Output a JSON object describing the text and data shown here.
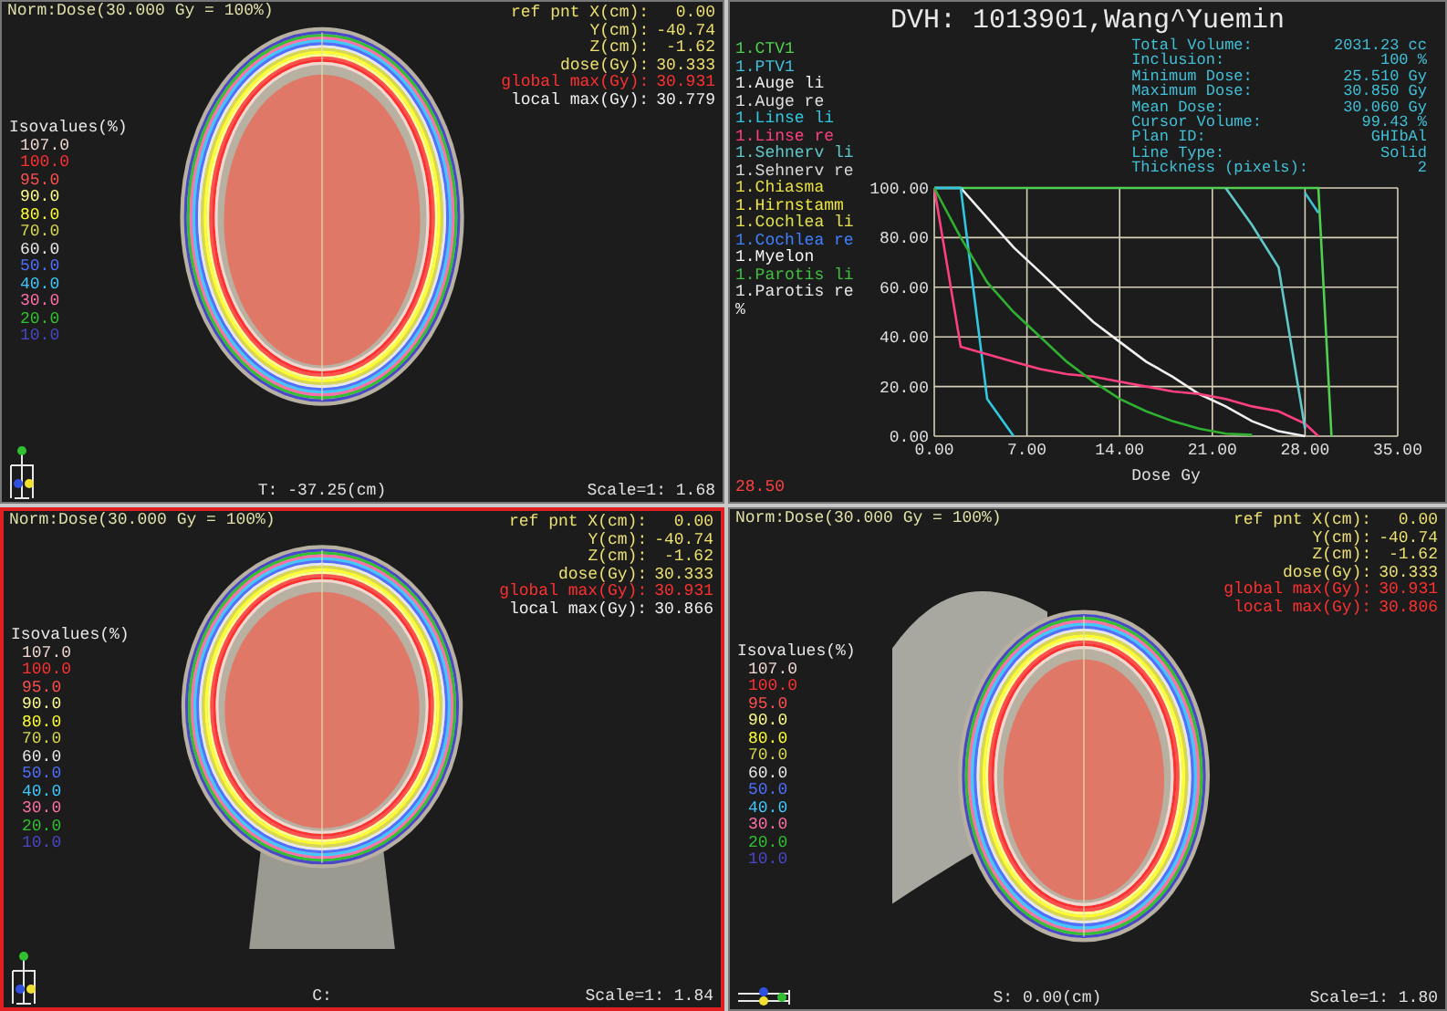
{
  "panels": [
    {
      "kind": "axial",
      "selected": false,
      "norm": "Norm:Dose(30.000 Gy = 100%)",
      "ref": [
        {
          "label": "ref pnt X(cm):",
          "value": "0.00",
          "kind": "value"
        },
        {
          "label": "Y(cm):",
          "value": "-40.74",
          "kind": "value"
        },
        {
          "label": "Z(cm):",
          "value": "-1.62",
          "kind": "value"
        },
        {
          "label": "dose(Gy):",
          "value": "30.333",
          "kind": "value"
        },
        {
          "label": "global max(Gy):",
          "value": "30.931",
          "kind": "global"
        },
        {
          "label": "local max(Gy):",
          "value": "30.779",
          "kind": "local"
        }
      ],
      "isovalues_title": "Isovalues(%)",
      "isovalues": [
        {
          "label": "107.0",
          "color": "#f0d8d0"
        },
        {
          "label": "100.0",
          "color": "#ff3030"
        },
        {
          "label": "95.0",
          "color": "#ff5050"
        },
        {
          "label": "90.0",
          "color": "#ffff90"
        },
        {
          "label": "80.0",
          "color": "#ffff30"
        },
        {
          "label": "70.0",
          "color": "#d8d850"
        },
        {
          "label": "60.0",
          "color": "#e8e8e8"
        },
        {
          "label": "50.0",
          "color": "#5070ff"
        },
        {
          "label": "40.0",
          "color": "#40c8ff"
        },
        {
          "label": "30.0",
          "color": "#ff70a8"
        },
        {
          "label": "20.0",
          "color": "#30c030"
        },
        {
          "label": "10.0",
          "color": "#4848c8"
        }
      ],
      "position": "T: -37.25(cm)",
      "scale": "Scale=1: 1.68"
    },
    {
      "kind": "dvh",
      "selected": false,
      "title": "DVH: 1013901,Wang^Yuemin",
      "structures": [
        {
          "label": "1.CTV1",
          "color": "#50d050"
        },
        {
          "label": "1.PTV1",
          "color": "#40c0d8"
        },
        {
          "label": "1.Auge li",
          "color": "#f0f0f0"
        },
        {
          "label": "1.Auge re",
          "color": "#e0e0e0"
        },
        {
          "label": "1.Linse li",
          "color": "#30c8e0"
        },
        {
          "label": "1.Linse re",
          "color": "#ff4080"
        },
        {
          "label": "1.Sehnerv li",
          "color": "#60c8c8"
        },
        {
          "label": "1.Sehnerv re",
          "color": "#d8d8d8"
        },
        {
          "label": "1.Chiasma",
          "color": "#e8e040"
        },
        {
          "label": "1.Hirnstamm",
          "color": "#f0e840"
        },
        {
          "label": "1.Cochlea li",
          "color": "#e0e050"
        },
        {
          "label": "1.Cochlea re",
          "color": "#4080ff"
        },
        {
          "label": "1.Myelon",
          "color": "#f8f8f8"
        },
        {
          "label": "1.Parotis li",
          "color": "#40c040"
        },
        {
          "label": "1.Parotis re",
          "color": "#e8e8e8"
        }
      ],
      "unit": "%",
      "cursor_dose": "28.50",
      "stats": [
        {
          "label": "Total Volume:",
          "value": "2031.23 cc"
        },
        {
          "label": "Inclusion:",
          "value": "100 %"
        },
        {
          "label": "Minimum Dose:",
          "value": "25.510 Gy"
        },
        {
          "label": "Maximum Dose:",
          "value": "30.850 Gy"
        },
        {
          "label": "Mean Dose:",
          "value": "30.060 Gy"
        },
        {
          "label": "Cursor Volume:",
          "value": "99.43 %"
        },
        {
          "label": "Plan ID:",
          "value": "GHIbAl"
        },
        {
          "label": "Line Type:",
          "value": "Solid"
        },
        {
          "label": "Thickness (pixels):",
          "value": "2"
        }
      ],
      "chart_data": {
        "type": "line",
        "grid": true,
        "xlabel": "Dose Gy",
        "xlim": [
          0,
          35
        ],
        "ylim": [
          0,
          100
        ],
        "xticks": [
          {
            "value": 0,
            "label": "0.00"
          },
          {
            "value": 7,
            "label": "7.00"
          },
          {
            "value": 14,
            "label": "14.00"
          },
          {
            "value": 21,
            "label": "21.00"
          },
          {
            "value": 28,
            "label": "28.00"
          },
          {
            "value": 35,
            "label": "35.00"
          }
        ],
        "yticks": [
          {
            "value": 0,
            "label": "0.00"
          },
          {
            "value": 20,
            "label": "20.00"
          },
          {
            "value": 40,
            "label": "40.00"
          },
          {
            "value": 60,
            "label": "60.00"
          },
          {
            "value": 80,
            "label": "80.00"
          },
          {
            "value": 100,
            "label": "100.00"
          }
        ],
        "x": [
          0,
          2,
          4,
          6,
          8,
          10,
          12,
          14,
          16,
          18,
          20,
          22,
          24,
          26,
          28,
          29,
          30
        ],
        "series": [
          {
            "color": "#50d050",
            "values": [
              100,
              100,
              100,
              100,
              100,
              100,
              100,
              100,
              100,
              100,
              100,
              100,
              100,
              100,
              100,
              100,
              0
            ]
          },
          {
            "color": "#40c0d8",
            "values": [
              null,
              null,
              null,
              null,
              null,
              null,
              null,
              null,
              null,
              null,
              null,
              null,
              null,
              null,
              98,
              90,
              null
            ]
          },
          {
            "color": "#f0f0f0",
            "values": [
              100,
              100,
              88,
              76,
              66,
              56,
              46,
              38,
              30,
              24,
              17,
              12,
              6,
              2,
              0,
              null,
              null
            ]
          },
          {
            "color": "#30c8e0",
            "values": [
              100,
              100,
              15,
              0,
              null,
              null,
              null,
              null,
              null,
              null,
              null,
              null,
              null,
              null,
              null,
              null,
              null
            ]
          },
          {
            "color": "#ff4080",
            "values": [
              100,
              36,
              33,
              30,
              27,
              25,
              24,
              22,
              20,
              18,
              17,
              15,
              12,
              10,
              5,
              0,
              null
            ]
          },
          {
            "color": "#60c8c8",
            "values": [
              null,
              null,
              null,
              null,
              null,
              null,
              null,
              null,
              null,
              null,
              null,
              100,
              85,
              68,
              3,
              null,
              null
            ]
          },
          {
            "color": "#30b030",
            "values": [
              100,
              80,
              62,
              50,
              40,
              30,
              22,
              15,
              10,
              6,
              3,
              1,
              0.5,
              null,
              null,
              null,
              null
            ]
          }
        ]
      }
    },
    {
      "kind": "coronal",
      "selected": true,
      "norm": "Norm:Dose(30.000 Gy = 100%)",
      "ref": [
        {
          "label": "ref pnt X(cm):",
          "value": "0.00",
          "kind": "value"
        },
        {
          "label": "Y(cm):",
          "value": "-40.74",
          "kind": "value"
        },
        {
          "label": "Z(cm):",
          "value": "-1.62",
          "kind": "value"
        },
        {
          "label": "dose(Gy):",
          "value": "30.333",
          "kind": "value"
        },
        {
          "label": "global max(Gy):",
          "value": "30.931",
          "kind": "global"
        },
        {
          "label": "local max(Gy):",
          "value": "30.866",
          "kind": "local"
        }
      ],
      "isovalues_title": "Isovalues(%)",
      "isovalues": [
        {
          "label": "107.0",
          "color": "#f0d8d0"
        },
        {
          "label": "100.0",
          "color": "#ff3030"
        },
        {
          "label": "95.0",
          "color": "#ff5050"
        },
        {
          "label": "90.0",
          "color": "#ffff90"
        },
        {
          "label": "80.0",
          "color": "#ffff30"
        },
        {
          "label": "70.0",
          "color": "#d8d850"
        },
        {
          "label": "60.0",
          "color": "#e8e8e8"
        },
        {
          "label": "50.0",
          "color": "#5070ff"
        },
        {
          "label": "40.0",
          "color": "#40c8ff"
        },
        {
          "label": "30.0",
          "color": "#ff70a8"
        },
        {
          "label": "20.0",
          "color": "#30c030"
        },
        {
          "label": "10.0",
          "color": "#4848c8"
        }
      ],
      "position": "C:",
      "scale": "Scale=1: 1.84"
    },
    {
      "kind": "sagittal",
      "selected": false,
      "norm": "Norm:Dose(30.000 Gy = 100%)",
      "ref": [
        {
          "label": "ref pnt X(cm):",
          "value": "0.00",
          "kind": "value"
        },
        {
          "label": "Y(cm):",
          "value": "-40.74",
          "kind": "value"
        },
        {
          "label": "Z(cm):",
          "value": "-1.62",
          "kind": "value"
        },
        {
          "label": "dose(Gy):",
          "value": "30.333",
          "kind": "value"
        },
        {
          "label": "global max(Gy):",
          "value": "30.931",
          "kind": "global"
        },
        {
          "label": "local max(Gy):",
          "value": "30.806",
          "kind": "global"
        }
      ],
      "isovalues_title": "Isovalues(%)",
      "isovalues": [
        {
          "label": "107.0",
          "color": "#f0d8d0"
        },
        {
          "label": "100.0",
          "color": "#ff3030"
        },
        {
          "label": "95.0",
          "color": "#ff5050"
        },
        {
          "label": "90.0",
          "color": "#ffff90"
        },
        {
          "label": "80.0",
          "color": "#ffff30"
        },
        {
          "label": "70.0",
          "color": "#d8d850"
        },
        {
          "label": "60.0",
          "color": "#e8e8e8"
        },
        {
          "label": "50.0",
          "color": "#5070ff"
        },
        {
          "label": "40.0",
          "color": "#40c8ff"
        },
        {
          "label": "30.0",
          "color": "#ff70a8"
        },
        {
          "label": "20.0",
          "color": "#30c030"
        },
        {
          "label": "10.0",
          "color": "#4848c8"
        }
      ],
      "position": "S:   0.00(cm)",
      "scale": "Scale=1: 1.80"
    }
  ]
}
